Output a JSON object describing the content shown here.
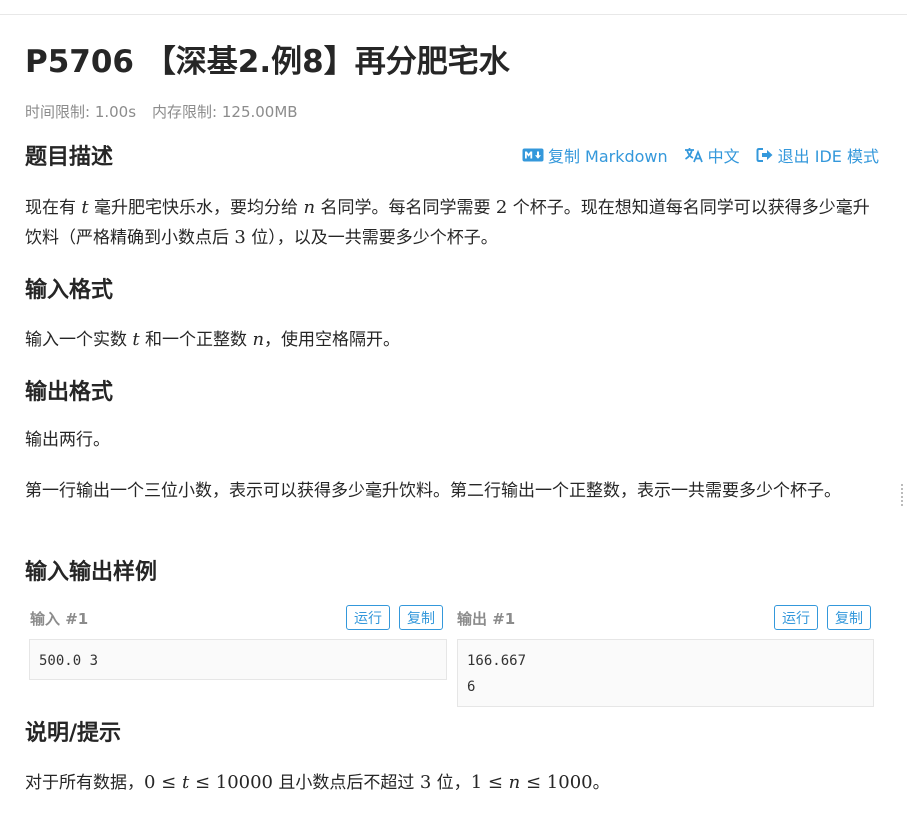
{
  "problem": {
    "title": "P5706 【深基2.例8】再分肥宅水",
    "time_limit_label": "时间限制: 1.00s",
    "memory_limit_label": "内存限制: 125.00MB"
  },
  "toolbar": {
    "copy_markdown": "复制 Markdown",
    "language": "中文",
    "exit_ide": "退出 IDE 模式",
    "accent_color": "#3498db"
  },
  "description": {
    "heading": "题目描述",
    "text": {
      "p1": "现在有 ",
      "var_t": "t",
      "p2": " 毫升肥宅快乐水，要均分给 ",
      "var_n": "n",
      "p3": " 名同学。每名同学需要 ",
      "num_2": "2",
      "p4": " 个杯子。现在想知道每名同学可以获得多少毫升饮料（严格精确到小数点后 ",
      "num_3": "3",
      "p5": " 位），以及一共需要多少个杯子。"
    }
  },
  "input_format": {
    "heading": "输入格式",
    "text": {
      "p1": "输入一个实数 ",
      "var_t": "t",
      "p2": " 和一个正整数 ",
      "var_n": "n",
      "p3": "，使用空格隔开。"
    }
  },
  "output_format": {
    "heading": "输出格式",
    "line1": "输出两行。",
    "line2": "第一行输出一个三位小数，表示可以获得多少毫升饮料。第二行输出一个正整数，表示一共需要多少个杯子。"
  },
  "samples": {
    "heading": "输入输出样例",
    "input_label": "输入 #1",
    "output_label": "输出 #1",
    "run_label": "运行",
    "copy_label": "复制",
    "input_text": "500.0 3",
    "output_text": "166.667\n6"
  },
  "hint": {
    "heading": "说明/提示",
    "text": {
      "p1": "对于所有数据，",
      "m1": "0 ≤ ",
      "var_t": "t",
      "m2": " ≤ 10000",
      "p2": " 且小数点后不超过 ",
      "num_3": "3",
      "p3": " 位，",
      "m3": "1 ≤ ",
      "var_n": "n",
      "m4": " ≤ 1000",
      "p4": "。"
    }
  }
}
